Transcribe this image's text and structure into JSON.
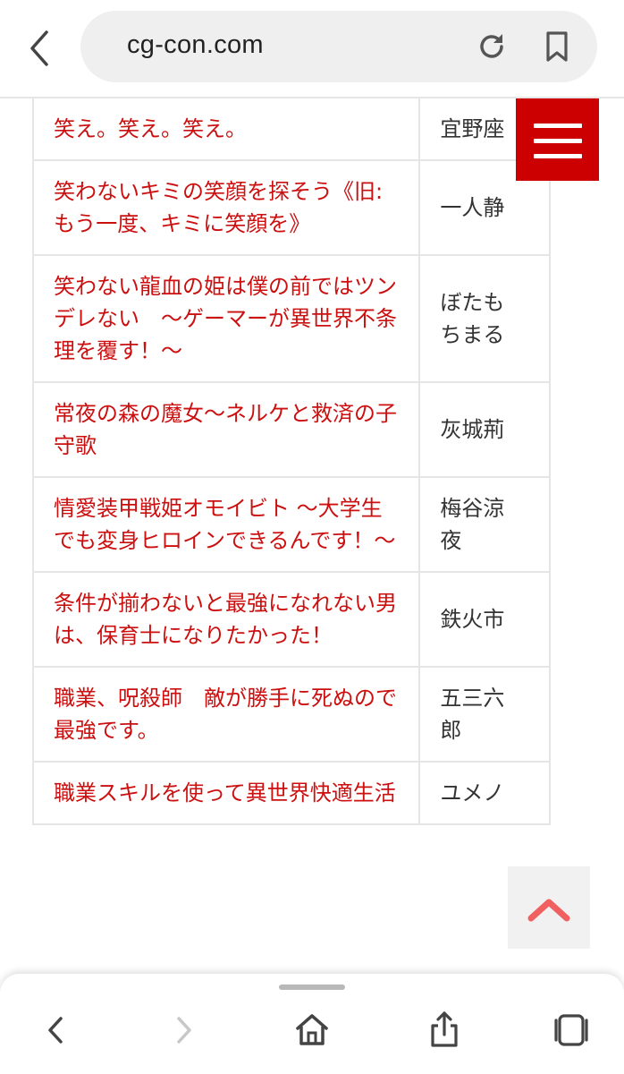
{
  "browser": {
    "url": "cg-con.com",
    "icons": [
      "back-arrow-icon",
      "reload-icon",
      "bookmark-icon"
    ]
  },
  "rows": [
    {
      "title": "笑え。笑え。笑え。",
      "author": "宜野座"
    },
    {
      "title": "笑わないキミの笑顔を探そう《旧:もう一度、キミに笑顔を》",
      "author": "一人静"
    },
    {
      "title": "笑わない龍血の姫は僕の前ではツンデレない　〜ゲーマーが異世界不条理を覆す！〜",
      "author": "ぼたもちまる"
    },
    {
      "title": "常夜の森の魔女〜ネルケと救済の子守歌",
      "author": "灰城荊"
    },
    {
      "title": "情愛装甲戦姫オモイビト 〜大学生でも変身ヒロインできるんです！〜",
      "author": "梅谷涼夜"
    },
    {
      "title": "条件が揃わないと最強になれない男は、保育士になりたかった！",
      "author": "鉄火市"
    },
    {
      "title": "職業、呪殺師　敵が勝手に死ぬので最強です。",
      "author": "五三六郎"
    },
    {
      "title": "職業スキルを使って異世界快適生活",
      "author": "ユメノ"
    }
  ],
  "colors": {
    "title_link": "#cc1010",
    "menu_bg": "#cc0000",
    "scroll_top_arrow": "#f06060"
  },
  "toolbar": {
    "icons": [
      "back-icon",
      "forward-icon",
      "home-icon",
      "share-icon",
      "tabs-icon"
    ]
  }
}
